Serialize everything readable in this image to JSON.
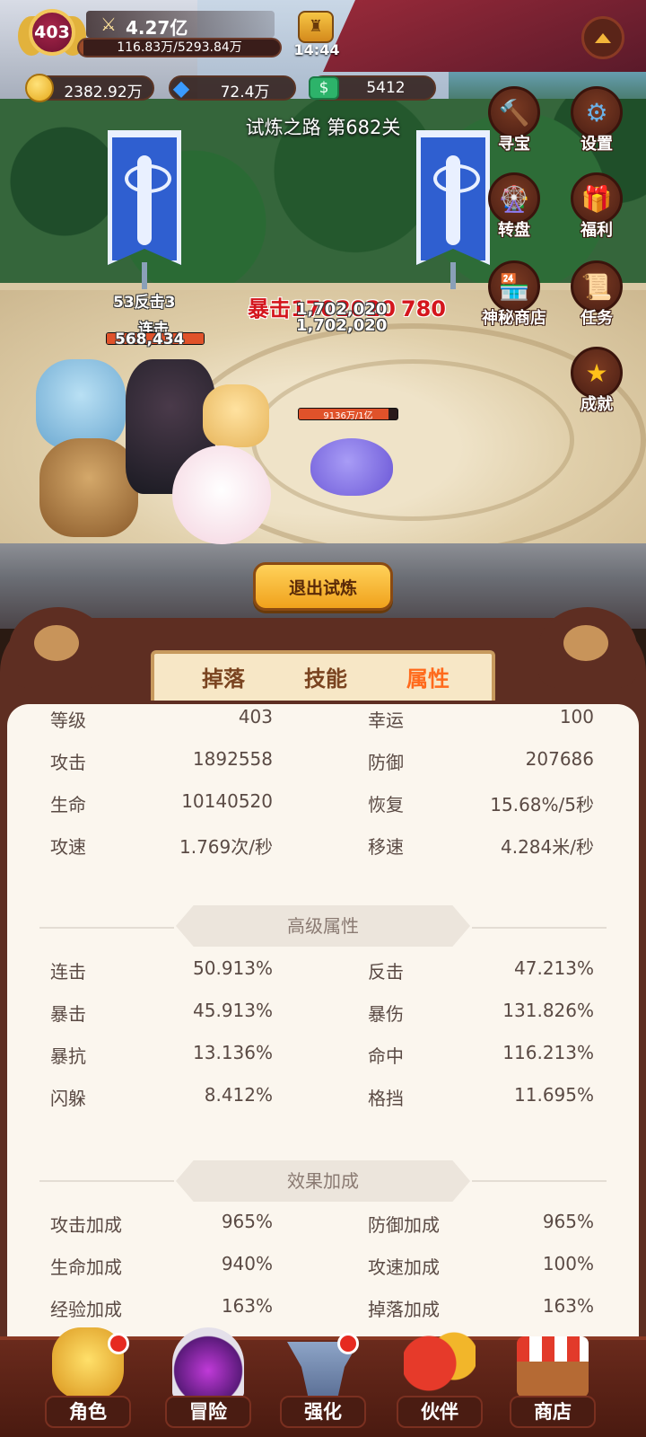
{
  "hud": {
    "level": "403",
    "power": "4.27亿",
    "exp_text": "116.83万/5293.84万",
    "exp_fraction": 0.022,
    "time": "14:44",
    "gold": "2382.92万",
    "gems": "72.4万",
    "cash": "5412"
  },
  "stage_title": "试炼之路 第682关",
  "side_buttons": [
    {
      "label": "寻宝",
      "icon": "hammer-icon"
    },
    {
      "label": "设置",
      "icon": "gear-icon"
    },
    {
      "label": "转盘",
      "icon": "wheel-icon"
    },
    {
      "label": "福利",
      "icon": "gift-icon"
    },
    {
      "label": "神秘商店",
      "icon": "shop-icon"
    },
    {
      "label": "任务",
      "icon": "scroll-icon"
    },
    {
      "label": "成就",
      "icon": "star-icon"
    }
  ],
  "battle": {
    "counter_text": "53反击3",
    "combo_text": "连击",
    "player_damage": "568,434",
    "crit_text": "暴击1702020",
    "crit_number": "780",
    "damage_a": "1,702,020",
    "damage_b": "1,702,020",
    "enemy_hp": "9136万/1亿",
    "enemy_hp_fraction": 0.91
  },
  "exit_button": "退出试炼",
  "tabs": [
    {
      "label": "掉落",
      "active": false
    },
    {
      "label": "技能",
      "active": false
    },
    {
      "label": "属性",
      "active": true
    }
  ],
  "basic_stats": [
    {
      "left_key": "等级",
      "left_val": "403",
      "right_key": "幸运",
      "right_val": "100"
    },
    {
      "left_key": "攻击",
      "left_val": "1892558",
      "right_key": "防御",
      "right_val": "207686"
    },
    {
      "left_key": "生命",
      "left_val": "10140520",
      "right_key": "恢复",
      "right_val": "15.68%/5秒"
    },
    {
      "left_key": "攻速",
      "left_val": "1.769次/秒",
      "right_key": "移速",
      "right_val": "4.284米/秒"
    }
  ],
  "advanced_title": "高级属性",
  "advanced_stats": [
    {
      "left_key": "连击",
      "left_val": "50.913%",
      "right_key": "反击",
      "right_val": "47.213%"
    },
    {
      "left_key": "暴击",
      "left_val": "45.913%",
      "right_key": "暴伤",
      "right_val": "131.826%"
    },
    {
      "left_key": "暴抗",
      "left_val": "13.136%",
      "right_key": "命中",
      "right_val": "116.213%"
    },
    {
      "left_key": "闪躲",
      "left_val": "8.412%",
      "right_key": "格挡",
      "right_val": "11.695%"
    }
  ],
  "effect_title": "效果加成",
  "effect_stats": [
    {
      "left_key": "攻击加成",
      "left_val": "965%",
      "right_key": "防御加成",
      "right_val": "965%"
    },
    {
      "left_key": "生命加成",
      "left_val": "940%",
      "right_key": "攻速加成",
      "right_val": "100%"
    },
    {
      "left_key": "经验加成",
      "left_val": "163%",
      "right_key": "掉落加成",
      "right_val": "163%"
    }
  ],
  "nav": [
    {
      "label": "角色",
      "badge": true
    },
    {
      "label": "冒险",
      "badge": false
    },
    {
      "label": "强化",
      "badge": true
    },
    {
      "label": "伙伴",
      "badge": false
    },
    {
      "label": "商店",
      "badge": false
    }
  ],
  "colors": {
    "accent_tab": "#ff6a1c",
    "badge_red": "#e62a20",
    "exit_button": "#f0a21c"
  }
}
